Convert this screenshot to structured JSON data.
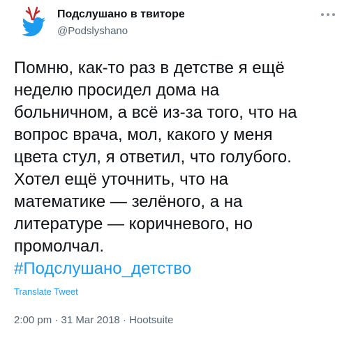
{
  "author": {
    "name": "Подслушано в твиторе",
    "handle": "@Podslyshano",
    "avatar_icon": "twitter-bird-with-antlers-icon"
  },
  "tweet": {
    "lines": [
      "Помню, как-то раз в детстве я ещё",
      "неделю просидел дома на",
      "больничном, а всё из-за того, что на",
      "вопрос врача, мол, какого у меня",
      "цвета стул, я ответил, что голубого.",
      "Хотел ещё уточнить, что на",
      "математике — зелёного, а на",
      "литературе — коричневого, но",
      "промолчал."
    ],
    "hashtag": "#Подслушано_детство",
    "translate_label": "Translate Tweet"
  },
  "meta": {
    "time": "2:00 pm",
    "date": "31 Mar 2018",
    "source": "Hootsuite",
    "separator": " · "
  },
  "colors": {
    "link": "#1d9bf0",
    "text": "#0f1419",
    "muted": "#536471",
    "bird": "#1d9bf0",
    "antlers": "#c0282d"
  }
}
